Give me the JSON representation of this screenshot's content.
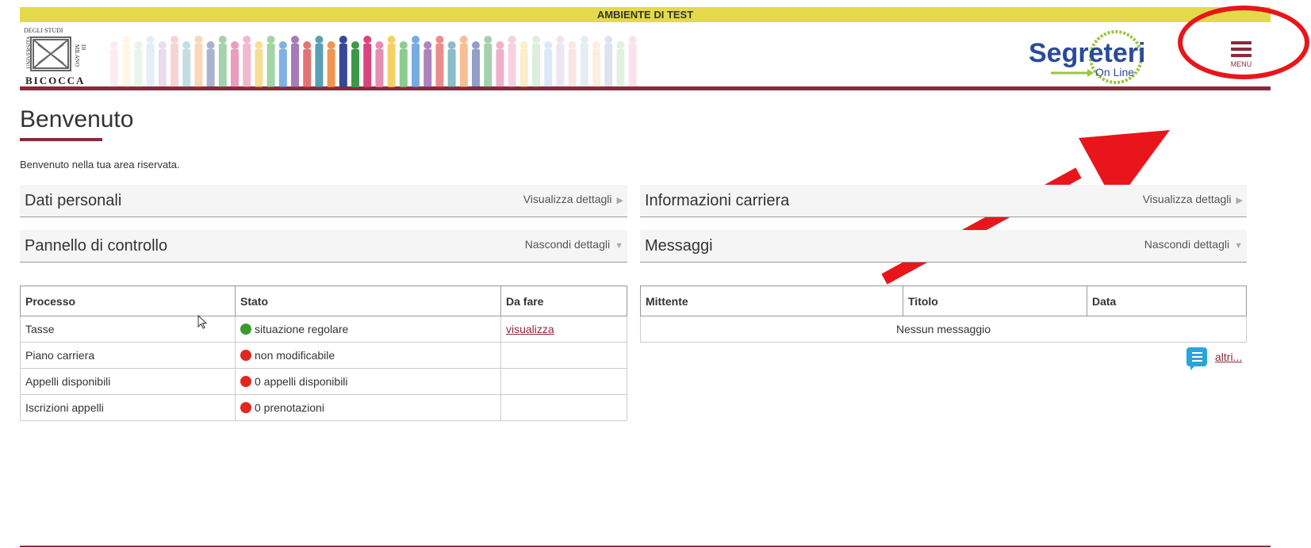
{
  "banner": {
    "text": "AMBIENTE DI TEST"
  },
  "header": {
    "logo": {
      "top": "DEGLI STUDI",
      "left_side": "UNIVERSITA",
      "right_side": "DI MILANO",
      "bottom": "BICOCCA"
    },
    "segreterie_logo": {
      "main": "Segreterie",
      "sub": "On Line"
    },
    "menu": {
      "label": "MENU"
    }
  },
  "page": {
    "title": "Benvenuto",
    "intro": "Benvenuto nella tua area riservata."
  },
  "sections": {
    "dati_personali": {
      "title": "Dati personali",
      "action": "Visualizza dettagli"
    },
    "informazioni_carriera": {
      "title": "Informazioni carriera",
      "action": "Visualizza dettagli"
    },
    "pannello": {
      "title": "Pannello di controllo",
      "action": "Nascondi dettagli"
    },
    "messaggi": {
      "title": "Messaggi",
      "action": "Nascondi dettagli"
    }
  },
  "control_table": {
    "headers": [
      "Processo",
      "Stato",
      "Da fare"
    ],
    "rows": [
      {
        "processo": "Tasse",
        "stato": "situazione regolare",
        "status_color": "#3a9a2e",
        "da_fare": "visualizza"
      },
      {
        "processo": "Piano carriera",
        "stato": "non modificabile",
        "status_color": "#e0281f",
        "da_fare": ""
      },
      {
        "processo": "Appelli disponibili",
        "stato": "0 appelli disponibili",
        "status_color": "#e0281f",
        "da_fare": ""
      },
      {
        "processo": "Iscrizioni appelli",
        "stato": "0 prenotazioni",
        "status_color": "#e0281f",
        "da_fare": ""
      }
    ]
  },
  "messages_table": {
    "headers": [
      "Mittente",
      "Titolo",
      "Data"
    ],
    "empty": "Nessun messaggio",
    "more": "altri..."
  },
  "colors": {
    "brand": "#8a2a3a",
    "banner": "#e4d94a",
    "annotation": "#e8161b"
  }
}
